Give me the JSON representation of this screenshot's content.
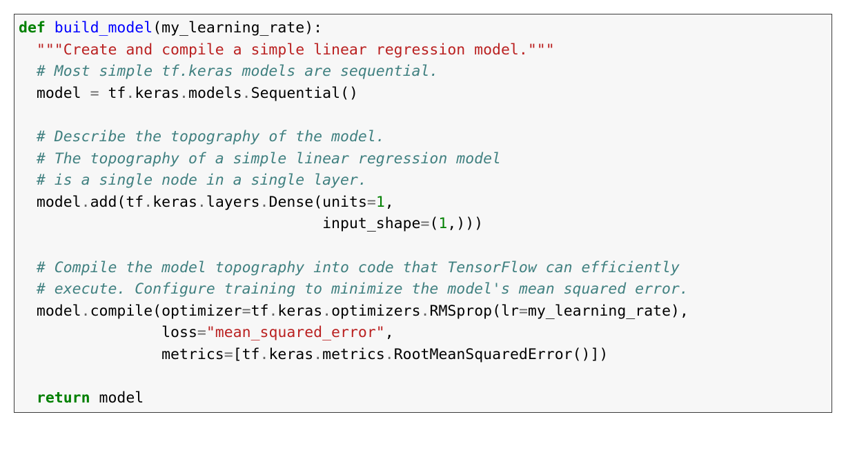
{
  "code": {
    "lines": [
      {
        "type": "line",
        "parts": [
          {
            "c": "kw",
            "t": "def"
          },
          {
            "c": "",
            "t": " "
          },
          {
            "c": "fn",
            "t": "build_model"
          },
          {
            "c": "",
            "t": "(my_learning_rate):"
          }
        ]
      },
      {
        "type": "line",
        "parts": [
          {
            "c": "",
            "t": "  "
          },
          {
            "c": "str",
            "t": "\"\"\"Create and compile a simple linear regression model.\"\"\""
          }
        ]
      },
      {
        "type": "line",
        "parts": [
          {
            "c": "",
            "t": "  "
          },
          {
            "c": "com",
            "t": "# Most simple tf.keras models are sequential."
          }
        ]
      },
      {
        "type": "line",
        "parts": [
          {
            "c": "",
            "t": "  model "
          },
          {
            "c": "op",
            "t": "="
          },
          {
            "c": "",
            "t": " tf"
          },
          {
            "c": "op",
            "t": "."
          },
          {
            "c": "",
            "t": "keras"
          },
          {
            "c": "op",
            "t": "."
          },
          {
            "c": "",
            "t": "models"
          },
          {
            "c": "op",
            "t": "."
          },
          {
            "c": "",
            "t": "Sequential()"
          }
        ]
      },
      {
        "type": "blank"
      },
      {
        "type": "line",
        "parts": [
          {
            "c": "",
            "t": "  "
          },
          {
            "c": "com",
            "t": "# Describe the topography of the model."
          }
        ]
      },
      {
        "type": "line",
        "parts": [
          {
            "c": "",
            "t": "  "
          },
          {
            "c": "com",
            "t": "# The topography of a simple linear regression model"
          }
        ]
      },
      {
        "type": "line",
        "parts": [
          {
            "c": "",
            "t": "  "
          },
          {
            "c": "com",
            "t": "# is a single node in a single layer."
          }
        ]
      },
      {
        "type": "line",
        "parts": [
          {
            "c": "",
            "t": "  model"
          },
          {
            "c": "op",
            "t": "."
          },
          {
            "c": "",
            "t": "add(tf"
          },
          {
            "c": "op",
            "t": "."
          },
          {
            "c": "",
            "t": "keras"
          },
          {
            "c": "op",
            "t": "."
          },
          {
            "c": "",
            "t": "layers"
          },
          {
            "c": "op",
            "t": "."
          },
          {
            "c": "",
            "t": "Dense(units"
          },
          {
            "c": "op",
            "t": "="
          },
          {
            "c": "nm",
            "t": "1"
          },
          {
            "c": "",
            "t": ","
          }
        ]
      },
      {
        "type": "line",
        "parts": [
          {
            "c": "",
            "t": "                                  input_shape"
          },
          {
            "c": "op",
            "t": "="
          },
          {
            "c": "",
            "t": "("
          },
          {
            "c": "nm",
            "t": "1"
          },
          {
            "c": "",
            "t": ",)))"
          }
        ]
      },
      {
        "type": "blank"
      },
      {
        "type": "line",
        "parts": [
          {
            "c": "",
            "t": "  "
          },
          {
            "c": "com",
            "t": "# Compile the model topography into code that TensorFlow can efficiently"
          }
        ]
      },
      {
        "type": "line",
        "parts": [
          {
            "c": "",
            "t": "  "
          },
          {
            "c": "com",
            "t": "# execute. Configure training to minimize the model's mean squared error."
          }
        ]
      },
      {
        "type": "line",
        "parts": [
          {
            "c": "",
            "t": "  model"
          },
          {
            "c": "op",
            "t": "."
          },
          {
            "c": "",
            "t": "compile(optimizer"
          },
          {
            "c": "op",
            "t": "="
          },
          {
            "c": "",
            "t": "tf"
          },
          {
            "c": "op",
            "t": "."
          },
          {
            "c": "",
            "t": "keras"
          },
          {
            "c": "op",
            "t": "."
          },
          {
            "c": "",
            "t": "optimizers"
          },
          {
            "c": "op",
            "t": "."
          },
          {
            "c": "",
            "t": "RMSprop(lr"
          },
          {
            "c": "op",
            "t": "="
          },
          {
            "c": "",
            "t": "my_learning_rate),"
          }
        ]
      },
      {
        "type": "line",
        "parts": [
          {
            "c": "",
            "t": "                loss"
          },
          {
            "c": "op",
            "t": "="
          },
          {
            "c": "str",
            "t": "\"mean_squared_error\""
          },
          {
            "c": "",
            "t": ","
          }
        ]
      },
      {
        "type": "line",
        "parts": [
          {
            "c": "",
            "t": "                metrics"
          },
          {
            "c": "op",
            "t": "="
          },
          {
            "c": "",
            "t": "[tf"
          },
          {
            "c": "op",
            "t": "."
          },
          {
            "c": "",
            "t": "keras"
          },
          {
            "c": "op",
            "t": "."
          },
          {
            "c": "",
            "t": "metrics"
          },
          {
            "c": "op",
            "t": "."
          },
          {
            "c": "",
            "t": "RootMeanSquaredError()])"
          }
        ]
      },
      {
        "type": "blank"
      },
      {
        "type": "line",
        "parts": [
          {
            "c": "",
            "t": "  "
          },
          {
            "c": "kw",
            "t": "return"
          },
          {
            "c": "",
            "t": " model"
          }
        ]
      }
    ]
  }
}
